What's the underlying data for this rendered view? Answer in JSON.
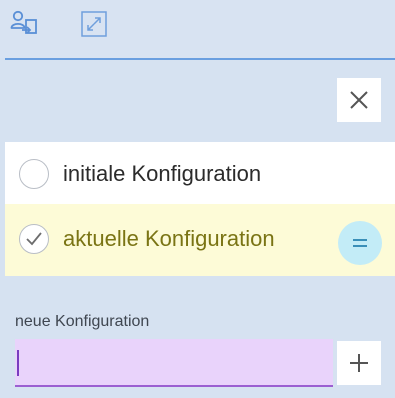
{
  "toolbar": {
    "icons": [
      "user-switch-icon",
      "expand-icon"
    ]
  },
  "dialog": {
    "close_icon": "close-icon"
  },
  "configurations": [
    {
      "label": "initiale Konfiguration",
      "selected": false
    },
    {
      "label": "aktuelle Konfiguration",
      "selected": true,
      "action_icon": "equals-icon"
    }
  ],
  "new_config": {
    "label": "neue Konfiguration",
    "value": "",
    "add_icon": "plus-icon"
  },
  "colors": {
    "panel_bg": "#d6e2f1",
    "accent_line": "#6a9fe0",
    "current_row_bg": "#fdfbd7",
    "current_row_text": "#7a7414",
    "equals_bg": "#c3ecf7",
    "input_bg": "#e9d3fb",
    "input_underline": "#9b5fd1"
  }
}
